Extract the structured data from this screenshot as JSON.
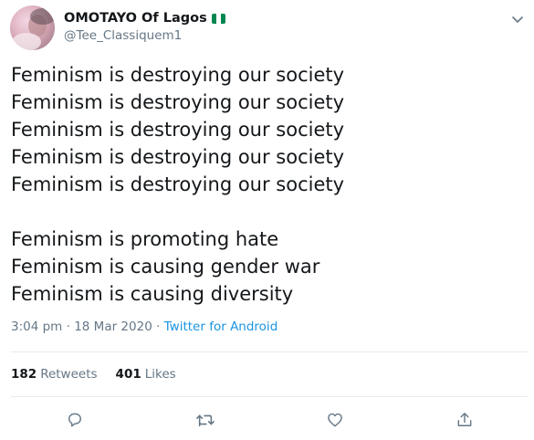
{
  "tweet": {
    "display_name": "OMOTAYO Of Lagos",
    "handle": "@Tee_Classiquem1",
    "lines_group1": [
      "Feminism is destroying our society",
      "Feminism is destroying our society",
      "Feminism is destroying our society",
      "Feminism is destroying our society",
      "Feminism is destroying our society"
    ],
    "lines_group2": [
      "Feminism is promoting hate",
      "Feminism is causing gender war",
      "Feminism is causing diversity"
    ],
    "time": "3:04 pm",
    "separator": " · ",
    "date": "18 Mar 2020",
    "source": "Twitter for Android",
    "retweet_count": "182",
    "retweet_label": "Retweets",
    "like_count": "401",
    "like_label": "Likes"
  },
  "icons": {
    "flag": "nigeria-flag-icon",
    "caret": "chevron-down-icon",
    "reply": "reply-icon",
    "retweet": "retweet-icon",
    "like": "heart-icon",
    "share": "share-icon"
  },
  "colors": {
    "text": "#14171a",
    "secondary": "#657786",
    "link": "#1b95e0",
    "divider": "#e6ecf0",
    "flag_green": "#008751",
    "flag_white": "#ffffff"
  }
}
